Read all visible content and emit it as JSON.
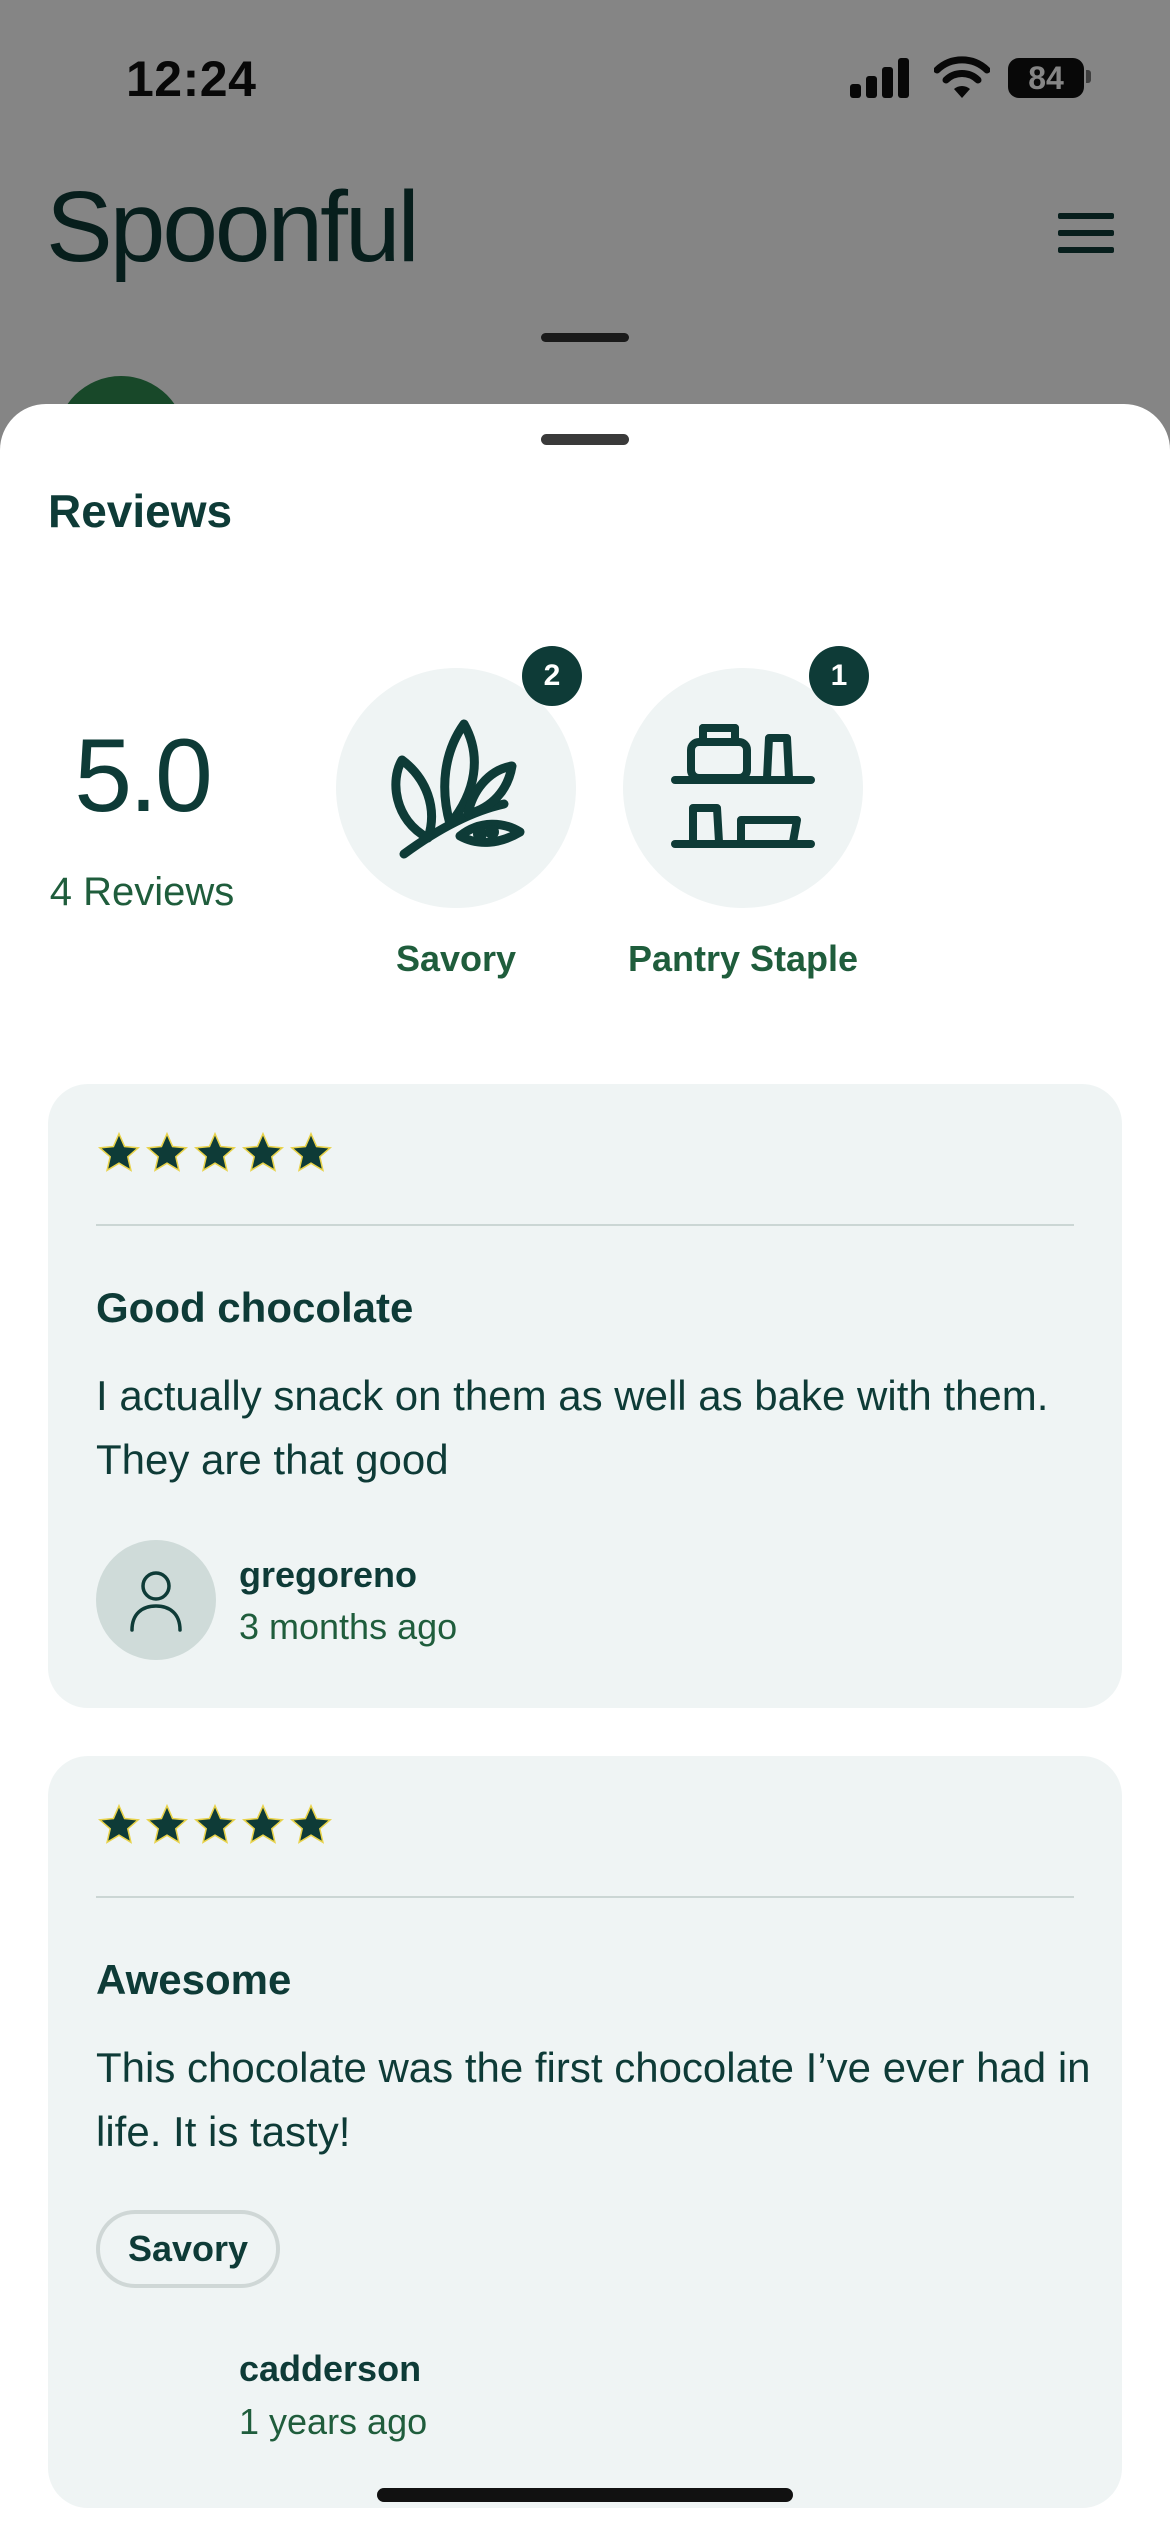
{
  "status_bar": {
    "time": "12:24",
    "battery": "84"
  },
  "background": {
    "brand": "Spoonful"
  },
  "reviews": {
    "title": "Reviews",
    "score": "5.0",
    "count_label": "4 Reviews",
    "categories": [
      {
        "label": "Savory",
        "count": "2",
        "icon": "leaf-icon"
      },
      {
        "label": "Pantry Staple",
        "count": "1",
        "icon": "pantry-shelf-icon"
      }
    ]
  },
  "review_cards": [
    {
      "stars": 5,
      "title": "Good chocolate",
      "body": "I actually snack on them as well as bake with them. They are that good",
      "username": "gregoreno",
      "time_ago": "3 months ago"
    },
    {
      "stars": 5,
      "title": "Awesome",
      "body": "This chocolate was the first chocolate I’ve ever had in life. It is tasty!",
      "tag": "Savory",
      "username": "cadderson",
      "time_ago": "1 years ago"
    }
  ],
  "colors": {
    "primary": "#0e3b37",
    "secondary_text": "#1f5d3c",
    "card_bg": "#eff4f4",
    "star_outline": "#e8d24a"
  }
}
